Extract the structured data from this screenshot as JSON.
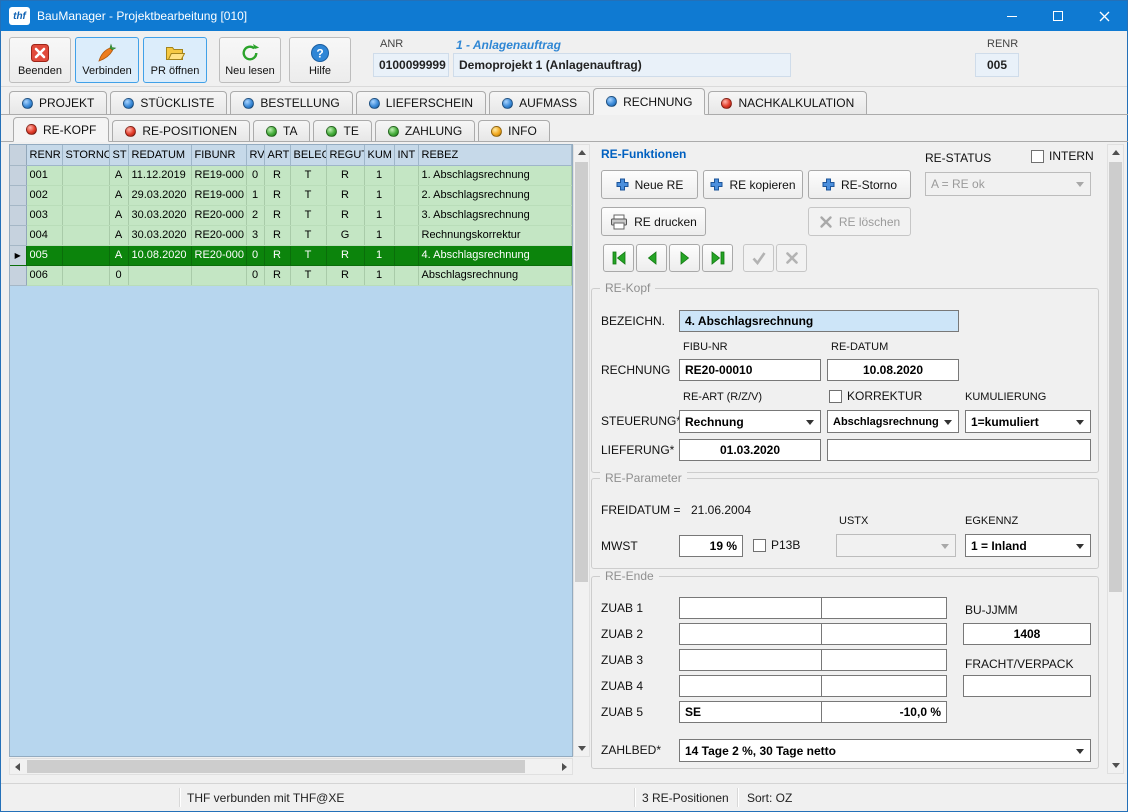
{
  "window": {
    "title": "BauManager - Projektbearbeitung [010]",
    "logo_text": "thf"
  },
  "toolbar": {
    "beenden_label": "Beenden",
    "verbinden_label": "Verbinden",
    "pr_oeffnen_label": "PR öffnen",
    "neu_lesen_label": "Neu lesen",
    "hilfe_label": "Hilfe",
    "anr_label": "ANR",
    "anr_value": "0100099999",
    "auftrag_info": "1 - Anlagenauftrag",
    "projekt_value": "Demoprojekt 1 (Anlagenauftrag)",
    "renr_label": "RENR",
    "renr_value": "005"
  },
  "main_tabs": [
    {
      "label": "PROJEKT",
      "dot": "blue",
      "active": false
    },
    {
      "label": "STÜCKLISTE",
      "dot": "blue",
      "active": false
    },
    {
      "label": "BESTELLUNG",
      "dot": "blue",
      "active": false
    },
    {
      "label": "LIEFERSCHEIN",
      "dot": "blue",
      "active": false
    },
    {
      "label": "AUFMASS",
      "dot": "blue",
      "active": false
    },
    {
      "label": "RECHNUNG",
      "dot": "blue",
      "active": true
    },
    {
      "label": "NACHKALKULATION",
      "dot": "red",
      "active": false
    }
  ],
  "sub_tabs": [
    {
      "label": "RE-KOPF",
      "dot": "red",
      "active": true
    },
    {
      "label": "RE-POSITIONEN",
      "dot": "red",
      "active": false
    },
    {
      "label": "TA",
      "dot": "green",
      "active": false
    },
    {
      "label": "TE",
      "dot": "green",
      "active": false
    },
    {
      "label": "ZAHLUNG",
      "dot": "green",
      "active": false
    },
    {
      "label": "INFO",
      "dot": "yellow",
      "active": false
    }
  ],
  "invoice_table": {
    "columns": [
      "RENR",
      "STORNO",
      "ST",
      "REDATUM",
      "FIBUNR",
      "RV",
      "ART",
      "BELEG",
      "REGUT",
      "KUM",
      "INT",
      "REBEZ"
    ],
    "rows": [
      [
        "001",
        "",
        "A",
        "11.12.2019",
        "RE19-000",
        "0",
        "R",
        "T",
        "R",
        "1",
        "",
        "1. Abschlagsrechnung"
      ],
      [
        "002",
        "",
        "A",
        "29.03.2020",
        "RE19-000",
        "1",
        "R",
        "T",
        "R",
        "1",
        "",
        "2. Abschlagsrechnung"
      ],
      [
        "003",
        "",
        "A",
        "30.03.2020",
        "RE20-000",
        "2",
        "R",
        "T",
        "R",
        "1",
        "",
        "3. Abschlagsrechnung"
      ],
      [
        "004",
        "",
        "A",
        "30.03.2020",
        "RE20-000",
        "3",
        "R",
        "T",
        "G",
        "1",
        "",
        "Rechnungskorrektur"
      ],
      [
        "005",
        "",
        "A",
        "10.08.2020",
        "RE20-000",
        "0",
        "R",
        "T",
        "R",
        "1",
        "",
        "4. Abschlagsrechnung"
      ],
      [
        "006",
        "",
        "0",
        "",
        "",
        "0",
        "R",
        "T",
        "R",
        "1",
        "",
        "Abschlagsrechnung"
      ]
    ],
    "selected_index": 4
  },
  "re_funktionen": {
    "title": "RE-Funktionen",
    "re_status_label": "RE-STATUS",
    "intern_label": "INTERN",
    "neue_re_label": "Neue RE",
    "re_kopieren_label": "RE kopieren",
    "re_storno_label": "RE-Storno",
    "re_drucken_label": "RE drucken",
    "re_loeschen_label": "RE löschen",
    "re_status_value": "A = RE ok"
  },
  "re_kopf": {
    "title": "RE-Kopf",
    "bezeichn_label": "BEZEICHN.",
    "bezeichn_value": "4. Abschlagsrechnung",
    "fibu_nr_label": "FIBU-NR",
    "re_datum_label": "RE-DATUM",
    "rechnung_label": "RECHNUNG",
    "fibu_nr_value": "RE20-00010",
    "re_datum_value": "10.08.2020",
    "re_art_label": "RE-ART (R/Z/V)",
    "korrektur_label": "KORREKTUR",
    "kumulierung_label": "KUMULIERUNG",
    "steuerung_label": "STEUERUNG*",
    "steuerung_value": "Rechnung",
    "re_art_value": "Abschlagsrechnung",
    "kumulierung_value": "1=kumuliert",
    "lieferung_label": "LIEFERUNG*",
    "lieferung_value": "01.03.2020",
    "lieferung_value2": ""
  },
  "re_parameter": {
    "title": "RE-Parameter",
    "freidatum_label": "FREIDATUM =",
    "freidatum_value": "21.06.2004",
    "ustx_label": "USTX",
    "egkennz_label": "EGKENNZ",
    "mwst_label": "MWST",
    "mwst_value": "19 %",
    "p13b_label": "P13B",
    "ustx_value": "",
    "egkennz_value": "1 = Inland"
  },
  "re_ende": {
    "title": "RE-Ende",
    "zuab1_label": "ZUAB 1",
    "zuab2_label": "ZUAB 2",
    "zuab3_label": "ZUAB 3",
    "zuab4_label": "ZUAB 4",
    "zuab5_label": "ZUAB 5",
    "zuab5_value1": "SE",
    "zuab5_value2": "-10,0 %",
    "bu_jjmm_label": "BU-JJMM",
    "bu_jjmm_value": "1408",
    "fracht_label": "FRACHT/VERPACK",
    "fracht_value": "",
    "zahlbed_label": "ZAHLBED*",
    "zahlbed_value": "14 Tage 2 %, 30 Tage netto"
  },
  "status_bar": {
    "connection": "THF verbunden mit THF@XE",
    "positions": "3 RE-Positionen",
    "sort": "Sort: OZ"
  },
  "colors": {
    "titlebar": "#0f7ad2",
    "selected_row": "#0c840c",
    "row_green": "#c4e6c4",
    "table_blue": "#b7d6ee",
    "dot_blue": "#3b8ad8",
    "dot_red": "#e23a28",
    "dot_green": "#43ab39",
    "dot_yellow": "#f2a81d"
  }
}
